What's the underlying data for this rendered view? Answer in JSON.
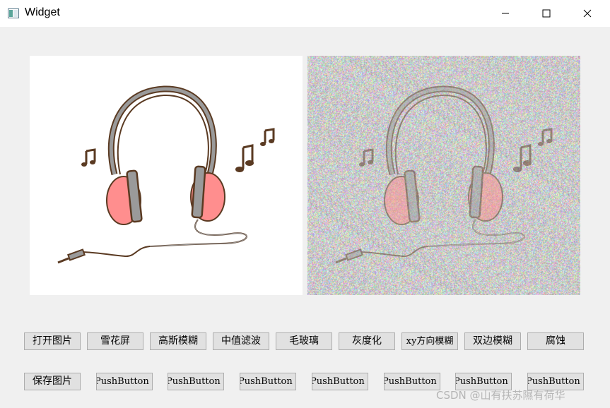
{
  "window": {
    "title": "Widget",
    "icon": "app-window-icon",
    "controls": {
      "minimize": "minimize-icon",
      "maximize": "maximize-icon",
      "close": "close-icon"
    }
  },
  "images": {
    "original": "headphones-illustration",
    "processed": "headphones-illustration-noise"
  },
  "colors": {
    "ear_pad": "#ff8e8e",
    "outline": "#5a3a22",
    "band": "#9a9a9a",
    "button_bg": "#e1e1e1",
    "window_bg": "#f0f0f0"
  },
  "buttons_row1": [
    "打开图片",
    "雪花屏",
    "高斯模糊",
    "中值滤波",
    "毛玻璃",
    "灰度化",
    "xy方向模糊",
    "双边模糊",
    "腐蚀"
  ],
  "buttons_row2": [
    "保存图片",
    "PushButton",
    "PushButton",
    "PushButton",
    "PushButton",
    "PushButton",
    "PushButton",
    "PushButton"
  ],
  "watermark": "CSDN @山有扶苏隰有荷华"
}
